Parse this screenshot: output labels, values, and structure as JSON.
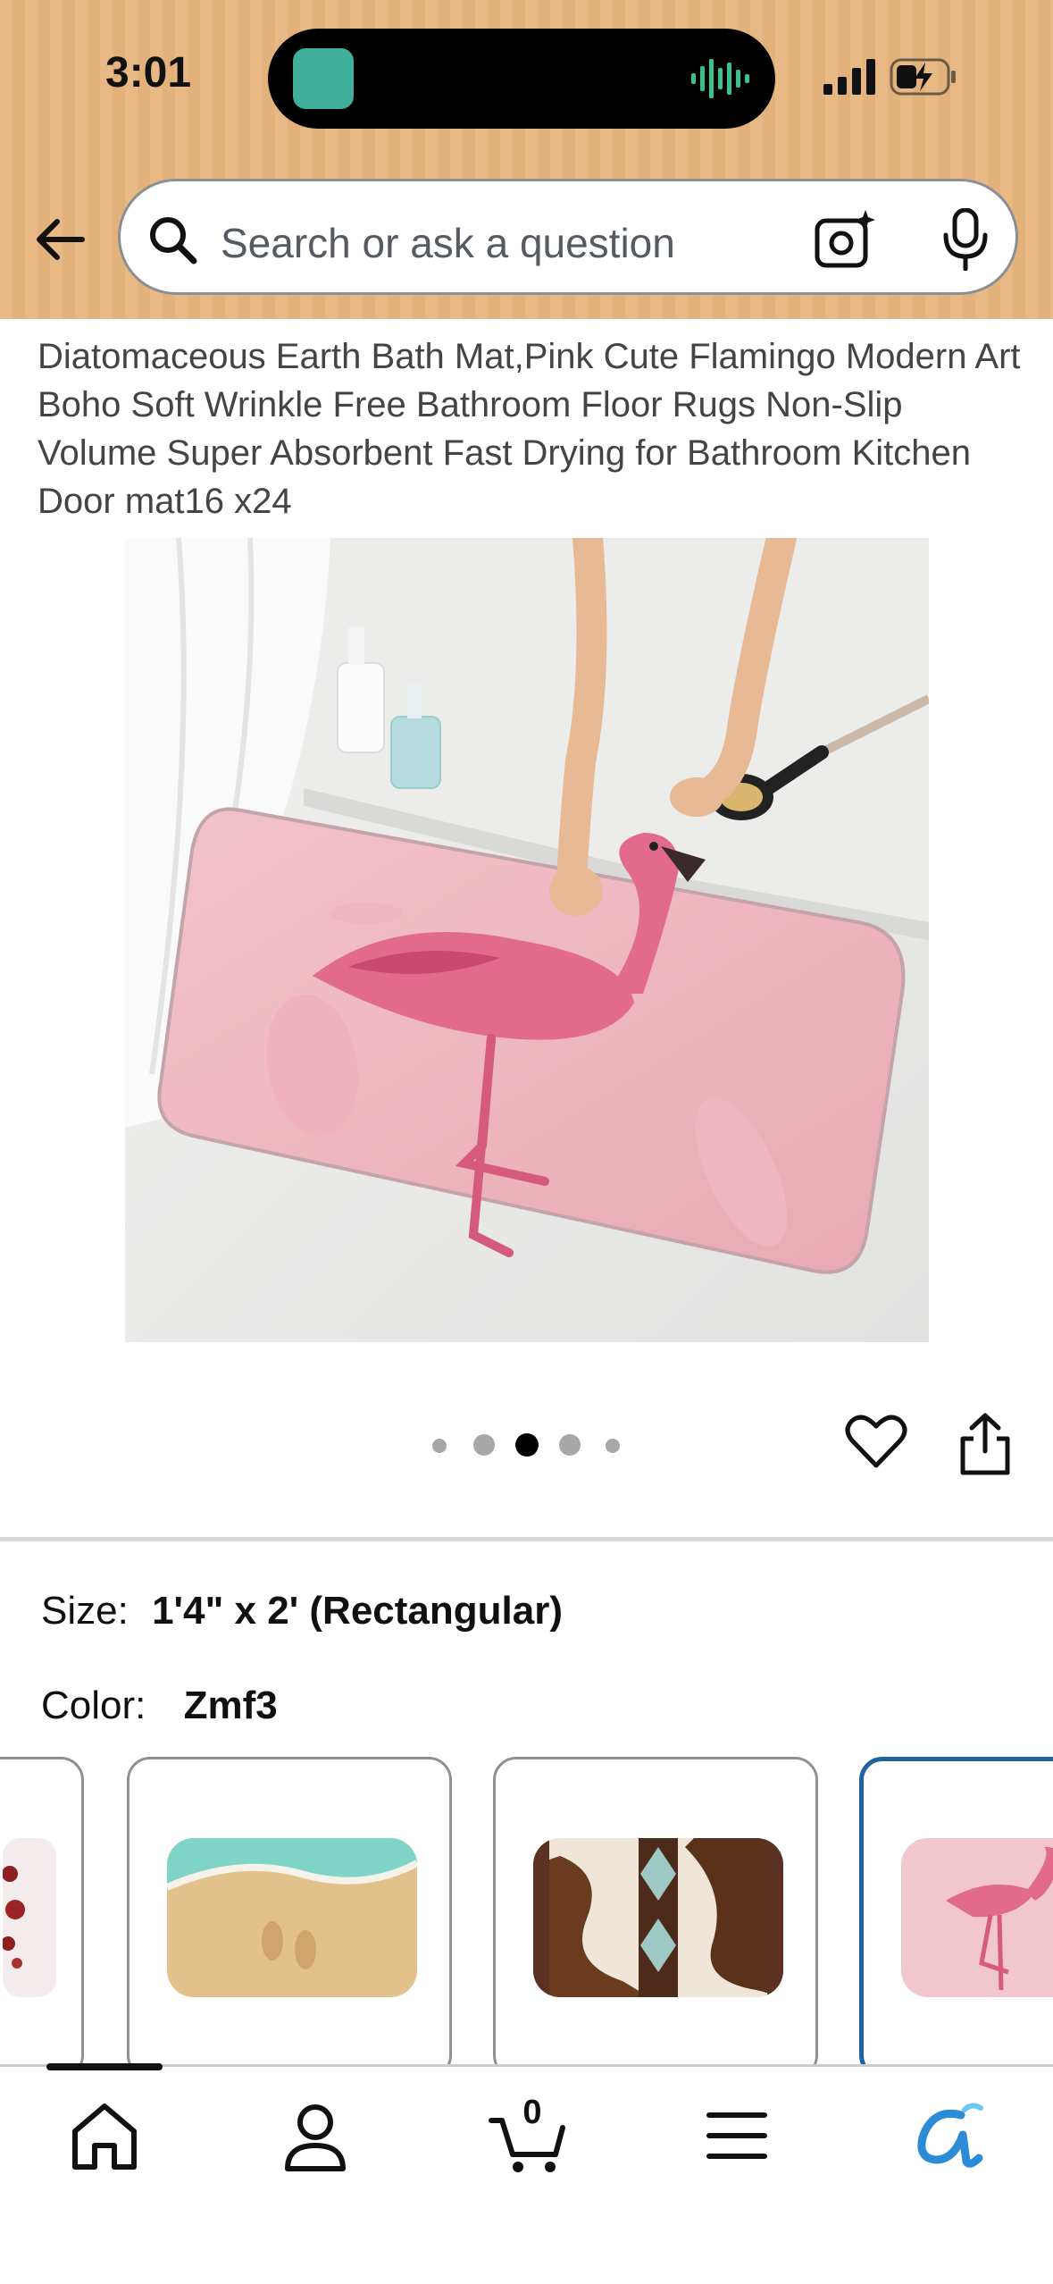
{
  "status_bar": {
    "time": "3:01"
  },
  "search": {
    "placeholder": "Search or ask a question"
  },
  "product": {
    "title": "Diatomaceous Earth Bath Mat,Pink Cute Flamingo Modern Art Boho Soft Wrinkle Free Bathroom Floor Rugs Non-Slip Volume Super Absorbent Fast Drying for Bathroom Kitchen Door mat16 x24",
    "image_carousel": {
      "total": 5,
      "active_index": 2
    }
  },
  "options": {
    "size_label": "Size:",
    "size_value": "1'4\" x 2' (Rectangular)",
    "color_label": "Color:",
    "color_value": "Zmf3",
    "swatches": [
      "red-pattern",
      "beach-footprints",
      "cowhide-aztec",
      "pink-flamingo"
    ],
    "selected_swatch": "pink-flamingo"
  },
  "bottom_nav": {
    "items": [
      "home-icon",
      "account-icon",
      "cart-icon",
      "menu-icon",
      "rufus-icon"
    ],
    "cart_count": "0",
    "active": "home"
  },
  "colors": {
    "header_bg": "#e8b985",
    "selected_border": "#2162a1",
    "rufus_blue": "#2c8bd6"
  }
}
